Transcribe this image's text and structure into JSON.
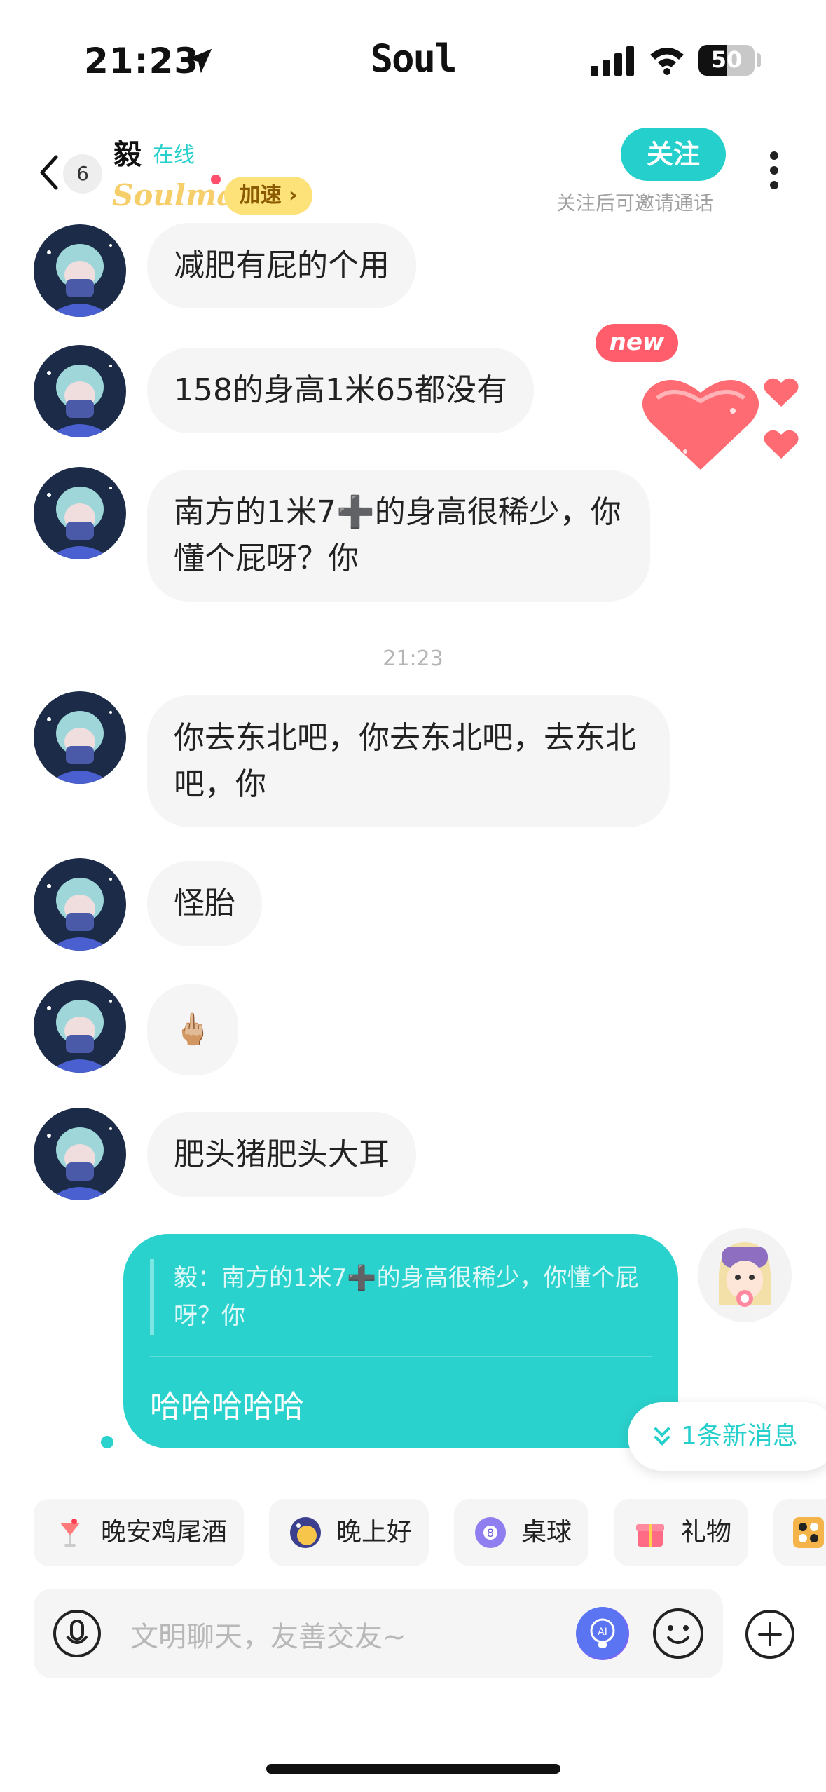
{
  "status_bar": {
    "time": "21:23",
    "app_name": "Soul",
    "battery": "50",
    "battery_level": 0.5
  },
  "header": {
    "unread_count": "6",
    "name": "毅",
    "online": "在线",
    "soulmate": "Soulmate",
    "speedup": "加速 ›",
    "follow": "关注",
    "follow_hint": "关注后可邀请通话"
  },
  "decoration": {
    "new_badge": "new"
  },
  "messages": [
    {
      "text": "减肥有屁的个用"
    },
    {
      "text": "158的身高1米65都没有"
    },
    {
      "text": "南方的1米7➕的身高很稀少，你懂个屁呀？你"
    },
    {
      "text": "你去东北吧，你去东北吧，去东北吧，你"
    },
    {
      "text": "怪胎"
    },
    {
      "text": "🖕🏼"
    },
    {
      "text": "肥头猪肥头大耳"
    }
  ],
  "time_separator": "21:23",
  "sent": {
    "quote": "毅：南方的1米7➕的身高很稀少，你懂个屁呀？你",
    "text": "哈哈哈哈哈"
  },
  "new_messages": "1条新消息",
  "quick_actions": [
    {
      "label": "晚安鸡尾酒",
      "icon": "cocktail-icon"
    },
    {
      "label": "晚上好",
      "icon": "moon-icon"
    },
    {
      "label": "桌球",
      "icon": "billiard-ball-icon"
    },
    {
      "label": "礼物",
      "icon": "gift-icon"
    },
    {
      "label": "",
      "icon": "gomoku-icon"
    }
  ],
  "input": {
    "placeholder": "文明聊天，友善交友~"
  },
  "colors": {
    "accent": "#25cfcb",
    "badge": "#ff5c6c",
    "bubble": "#f5f5f5"
  }
}
